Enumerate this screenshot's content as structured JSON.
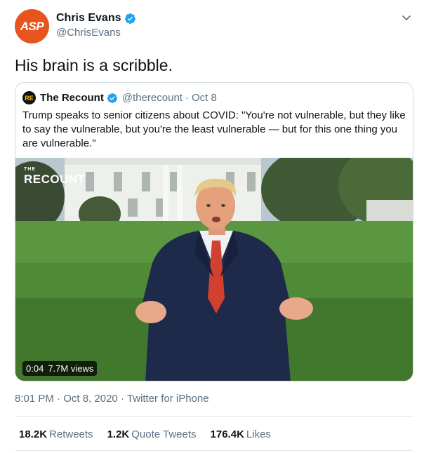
{
  "author": {
    "avatar_text": "ASP",
    "name": "Chris Evans",
    "handle": "@ChrisEvans",
    "avatar_color": "#e8531e"
  },
  "tweet": {
    "text": "His brain is a scribble."
  },
  "quoted": {
    "logo_text": "RE",
    "name": "The Recount",
    "handle": "@therecount",
    "separator": "·",
    "date": "Oct 8",
    "text": "Trump speaks to senior citizens about COVID: \"You're not vulnerable, but they like to say the vulnerable, but you're the least vulnerable — but for this one thing you are vulnerable.\"",
    "media": {
      "watermark_small": "THE",
      "watermark": "RECOUNT",
      "duration": "0:04",
      "views": "7.7M views"
    }
  },
  "meta": {
    "time": "8:01 PM",
    "sep1": "·",
    "date": "Oct 8, 2020",
    "sep2": "·",
    "source": "Twitter for iPhone"
  },
  "stats": {
    "retweets_count": "18.2K",
    "retweets_label": "Retweets",
    "quotes_count": "1.2K",
    "quotes_label": "Quote Tweets",
    "likes_count": "176.4K",
    "likes_label": "Likes"
  },
  "colors": {
    "verified": "#1da1f2",
    "secondary_text": "#5b7083",
    "border": "#cfd9de"
  },
  "icons": {
    "verified": "verified-badge-icon",
    "more": "chevron-down-icon"
  }
}
